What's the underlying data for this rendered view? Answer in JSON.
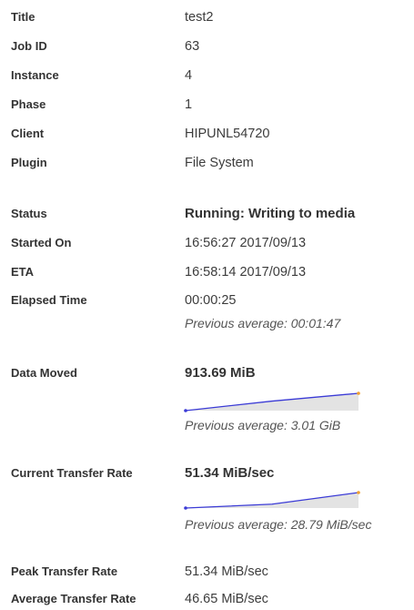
{
  "fields": {
    "title": {
      "label": "Title",
      "value": "test2"
    },
    "job_id": {
      "label": "Job ID",
      "value": "63"
    },
    "instance": {
      "label": "Instance",
      "value": "4"
    },
    "phase": {
      "label": "Phase",
      "value": "1"
    },
    "client": {
      "label": "Client",
      "value": "HIPUNL54720"
    },
    "plugin": {
      "label": "Plugin",
      "value": "File System"
    },
    "status": {
      "label": "Status",
      "value": "Running: Writing to media"
    },
    "started_on": {
      "label": "Started On",
      "value": "16:56:27 2017/09/13"
    },
    "eta": {
      "label": "ETA",
      "value": "16:58:14 2017/09/13"
    },
    "elapsed_time": {
      "label": "Elapsed Time",
      "value": "00:00:25",
      "previous": "Previous average: 00:01:47"
    },
    "data_moved": {
      "label": "Data Moved",
      "value": "913.69 MiB",
      "previous": "Previous average: 3.01 GiB"
    },
    "current_transfer_rate": {
      "label": "Current Transfer Rate",
      "value": "51.34 MiB/sec",
      "previous": "Previous average: 28.79 MiB/sec"
    },
    "peak_transfer_rate": {
      "label": "Peak Transfer Rate",
      "value": "51.34 MiB/sec"
    },
    "average_transfer_rate": {
      "label": "Average Transfer Rate",
      "value": "46.65 MiB/sec"
    }
  },
  "sparklines": {
    "line_color": "#3b3bd6",
    "fill_color": "#e3e3e3",
    "end_point_color": "#f0a030",
    "data_moved": [
      0.0,
      0.55,
      1.0
    ],
    "current_transfer_rate": [
      0.0,
      0.25,
      1.0
    ]
  }
}
